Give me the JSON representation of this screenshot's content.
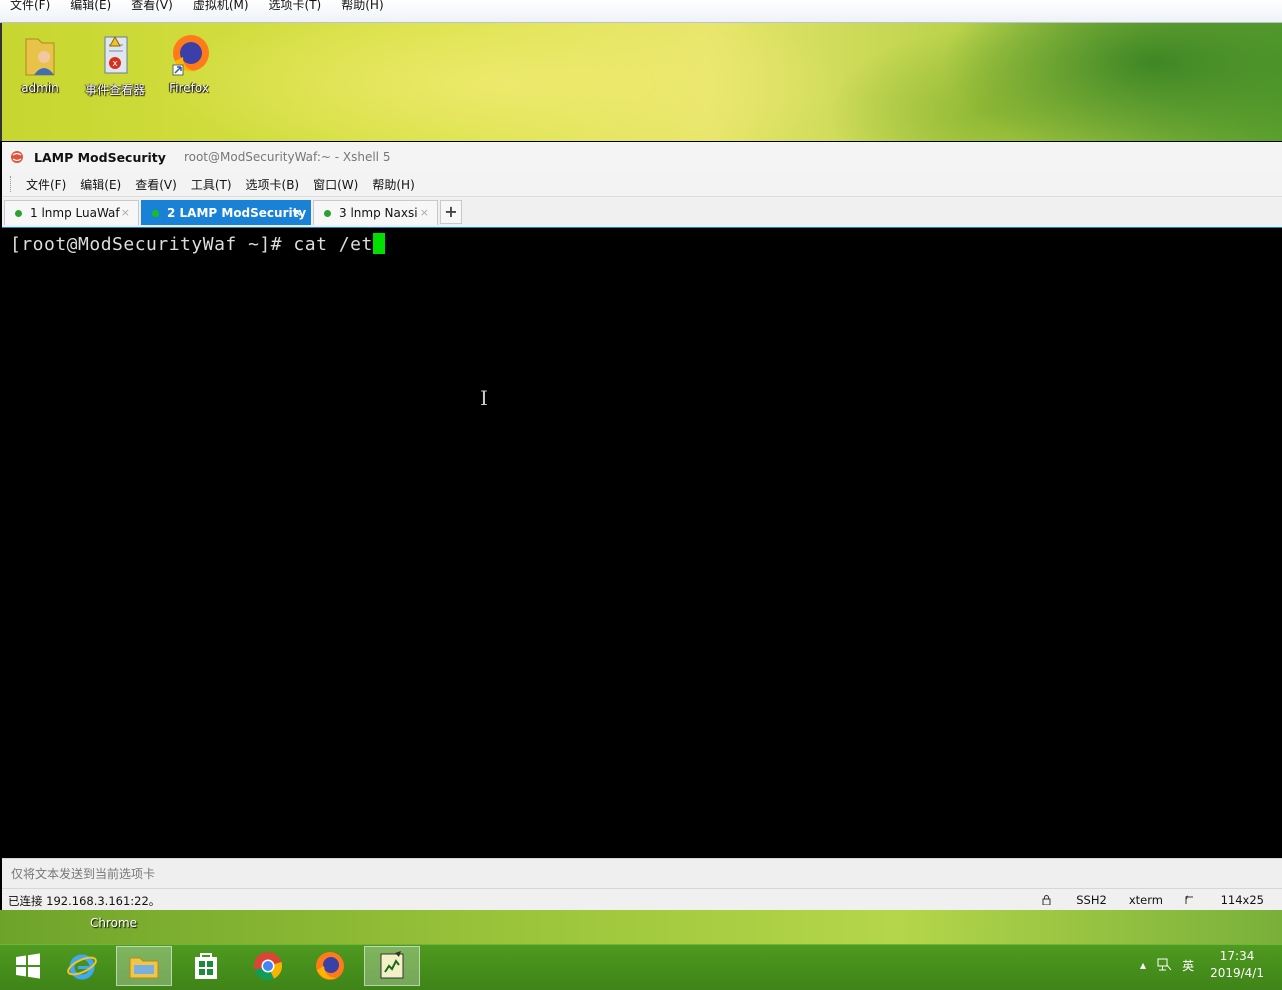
{
  "vm_menu": [
    "文件(F)",
    "编辑(E)",
    "查看(V)",
    "虚拟机(M)",
    "选项卡(T)",
    "帮助(H)"
  ],
  "desktop_icons": [
    "admin",
    "事件查看器",
    "Firefox"
  ],
  "xshell": {
    "title_main": "LAMP ModSecurity",
    "title_sub": "root@ModSecurityWaf:~ - Xshell 5",
    "menu": [
      "文件(F)",
      "编辑(E)",
      "查看(V)",
      "工具(T)",
      "选项卡(B)",
      "窗口(W)",
      "帮助(H)"
    ],
    "tabs": [
      {
        "label": "1 lnmp LuaWaf",
        "active": false
      },
      {
        "label": "2 LAMP ModSecurity",
        "active": true
      },
      {
        "label": "3 lnmp Naxsi",
        "active": false
      }
    ],
    "tab_add": "+",
    "tab_close": "×",
    "terminal_prompt": "[root@ModSecurityWaf ~]# cat /et",
    "send_hint": "仅将文本发送到当前选项卡",
    "status_connected": "已连接 192.168.3.161:22。",
    "status_protocol": "SSH2",
    "status_term": "xterm",
    "status_size": "114x25"
  },
  "desktop_strip_label": "Chrome",
  "taskbar": {
    "tray_lang": "英",
    "clock_time": "17:34",
    "clock_date": "2019/4/1"
  },
  "colors": {
    "accent": "#1a82d6",
    "cursor": "#00e000",
    "taskbar": "#4a9320"
  }
}
